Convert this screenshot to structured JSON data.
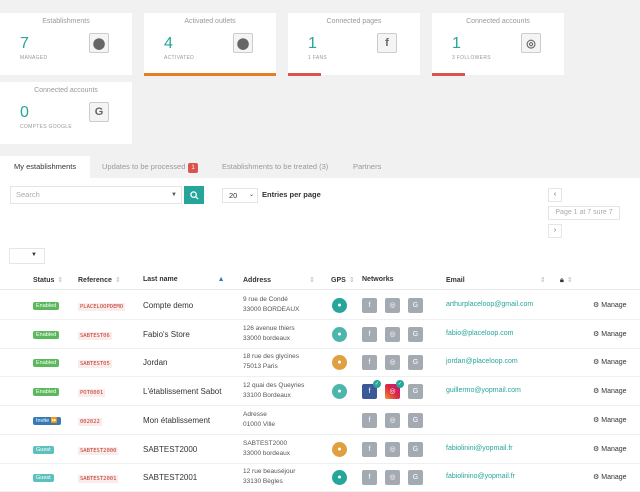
{
  "cards": [
    {
      "title": "Establishments",
      "number": "7",
      "sub": "MANAGED",
      "icon": "map-pin-icon",
      "glyph": "⬤"
    },
    {
      "title": "Activated outlets",
      "number": "4",
      "sub": "ACTIVATED",
      "icon": "map-pin-icon",
      "glyph": "⬤",
      "bar_color": "#e67e22",
      "bar_level": 1.0
    },
    {
      "title": "Connected pages",
      "number": "1",
      "sub": "1 FANS",
      "icon": "facebook-icon",
      "glyph": "f",
      "bar_color": "#d9534f",
      "bar_level": 0.25
    },
    {
      "title": "Connected accounts",
      "number": "1",
      "sub": "3 FOLLOWERS",
      "icon": "instagram-icon",
      "glyph": "◎",
      "bar_color": "#d9534f",
      "bar_level": 0.25
    },
    {
      "title": "Connected accounts",
      "number": "0",
      "sub": "COMPTES GOOGLE",
      "icon": "google-icon",
      "glyph": "G"
    }
  ],
  "tabs": {
    "my_establishments": "My establishments",
    "updates": "Updates to be processed",
    "updates_count": "1",
    "to_treat": "Establishments to be treated (3)",
    "partners": "Partners"
  },
  "search": {
    "placeholder": "Search"
  },
  "entries": {
    "value": "20",
    "label": "Entries per page"
  },
  "pagination": {
    "prev": "‹",
    "info": "Page 1 at 7 sure 7",
    "next": "›"
  },
  "columns": {
    "status": "Status",
    "reference": "Reference",
    "last_name": "Last name",
    "address": "Address",
    "gps": "GPS",
    "networks": "Networks",
    "email": "Email"
  },
  "rows": [
    {
      "status": "Enabled",
      "ref": "PLACELOOPDEMO",
      "name": "Compte demo",
      "addr1": "9 rue de Condé",
      "addr2": "33000 BORDEAUX",
      "gps_color": "#26a69a",
      "fb": false,
      "ig": false,
      "email": "arthurplaceloop@gmail.com",
      "manage": "Manage"
    },
    {
      "status": "Enabled",
      "ref": "SABTEST06",
      "name": "Fabio's Store",
      "addr1": "126 avenue thiers",
      "addr2": "33000 bordeaux",
      "gps_color": "#4db6ac",
      "fb": false,
      "ig": false,
      "email": "fabio@placeloop.com",
      "manage": "Manage"
    },
    {
      "status": "Enabled",
      "ref": "SABTEST05",
      "name": "Jordan",
      "addr1": "18 rue des glycines",
      "addr2": "75013 Paris",
      "gps_color": "#e0a040",
      "fb": false,
      "ig": false,
      "email": "jordan@placeloop.com",
      "manage": "Manage"
    },
    {
      "status": "Enabled",
      "ref": "POT0001",
      "name": "L'établissement Sabot",
      "addr1": "12 quai des Queyries",
      "addr2": "33100 Bordeaux",
      "gps_color": "#4db6ac",
      "fb": true,
      "ig": true,
      "email": "guillermo@yopmail.com",
      "manage": "Manage"
    },
    {
      "status": "Invite ⏩",
      "ref": "002022",
      "name": "Mon établissement",
      "addr1": "Adresse",
      "addr2": "01000 Ville",
      "gps_color": "",
      "fb": false,
      "ig": false,
      "email": "",
      "manage": "Manage"
    },
    {
      "status": "Guest",
      "ref": "SABTEST2000",
      "name": "SABTEST2000",
      "addr1": "SABTEST2000",
      "addr2": "33000 bordeaux",
      "gps_color": "#e0a040",
      "fb": false,
      "ig": false,
      "email": "fabiolinini@yopmail.fr",
      "manage": "Manage"
    },
    {
      "status": "Guest",
      "ref": "SABTEST2001",
      "name": "SABTEST2001",
      "addr1": "12 rue beauséjour",
      "addr2": "33130 Bègles",
      "gps_color": "#26a69a",
      "fb": false,
      "ig": false,
      "email": "fabiolinino@yopmail.fr",
      "manage": "Manage"
    }
  ],
  "status_colors": {
    "Enabled": "#5cb85c",
    "Guest": "#5bc0be",
    "Invite ⏩": "#337ab7"
  }
}
